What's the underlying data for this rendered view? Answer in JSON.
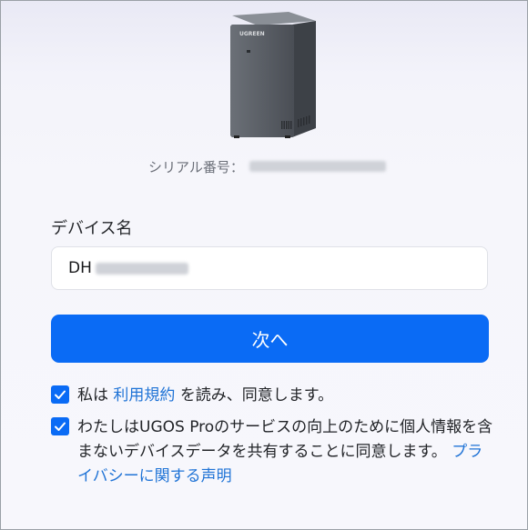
{
  "device_image": {
    "brand": "UGREEN",
    "icon": "nas-device-image"
  },
  "serial": {
    "label": "シリアル番号：",
    "value_redacted": true
  },
  "device_name": {
    "label": "デバイス名",
    "value_prefix": "DH",
    "value_redacted": true
  },
  "next_button": {
    "label": "次へ"
  },
  "terms_agreement": {
    "checked": true,
    "prefix": "私は",
    "link": "利用規約",
    "suffix": "を読み、同意します。"
  },
  "privacy_agreement": {
    "checked": true,
    "text": "わたしはUGOS Proのサービスの向上のために個人情報を含まないデバイスデータを共有することに同意します。",
    "link": "プライバシーに関する声明"
  },
  "colors": {
    "accent": "#0a6bf5",
    "link": "#1f73d6"
  }
}
